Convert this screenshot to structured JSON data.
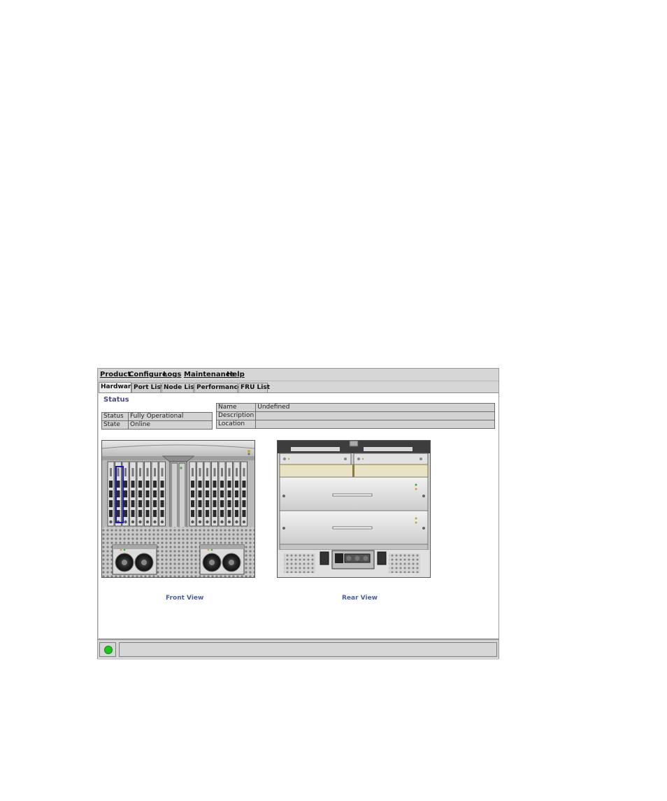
{
  "menu": [
    "Product",
    "Configure",
    "Logs",
    "Maintenance",
    "Help"
  ],
  "tabs": [
    "Hardware",
    "Port List",
    "Node List",
    "Performance",
    "FRU List"
  ],
  "active_tab": "Hardware",
  "section_title": "Status",
  "status_table": [
    {
      "label": "Status",
      "value": "Fully Operational"
    },
    {
      "label": "State",
      "value": "Online"
    }
  ],
  "info_table": [
    {
      "label": "Name",
      "value": "Undefined"
    },
    {
      "label": "Description",
      "value": ""
    },
    {
      "label": "Location",
      "value": ""
    }
  ],
  "front_view_label": "Front View",
  "rear_view_label": "Rear View",
  "status_indicator_color": "#1ac81a"
}
